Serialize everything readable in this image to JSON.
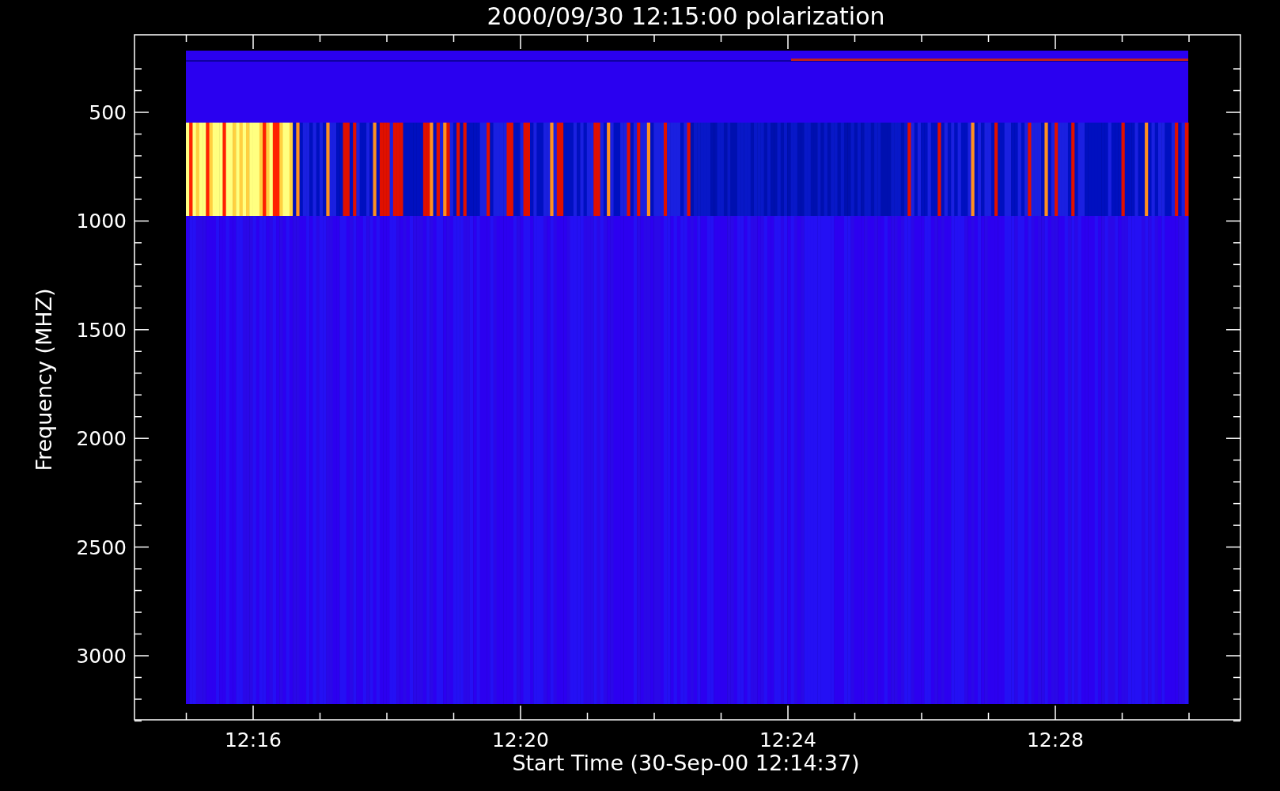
{
  "plot": {
    "title": "2000/09/30 12:15:00 polarization",
    "xlabel": "Start Time (30-Sep-00 12:14:37)",
    "ylabel": "Frequency (MHZ)",
    "xticks": [
      "12:16",
      "12:20",
      "12:24",
      "12:28"
    ],
    "yticks": [
      "500",
      "1000",
      "1500",
      "2000",
      "2500",
      "3000"
    ]
  }
}
